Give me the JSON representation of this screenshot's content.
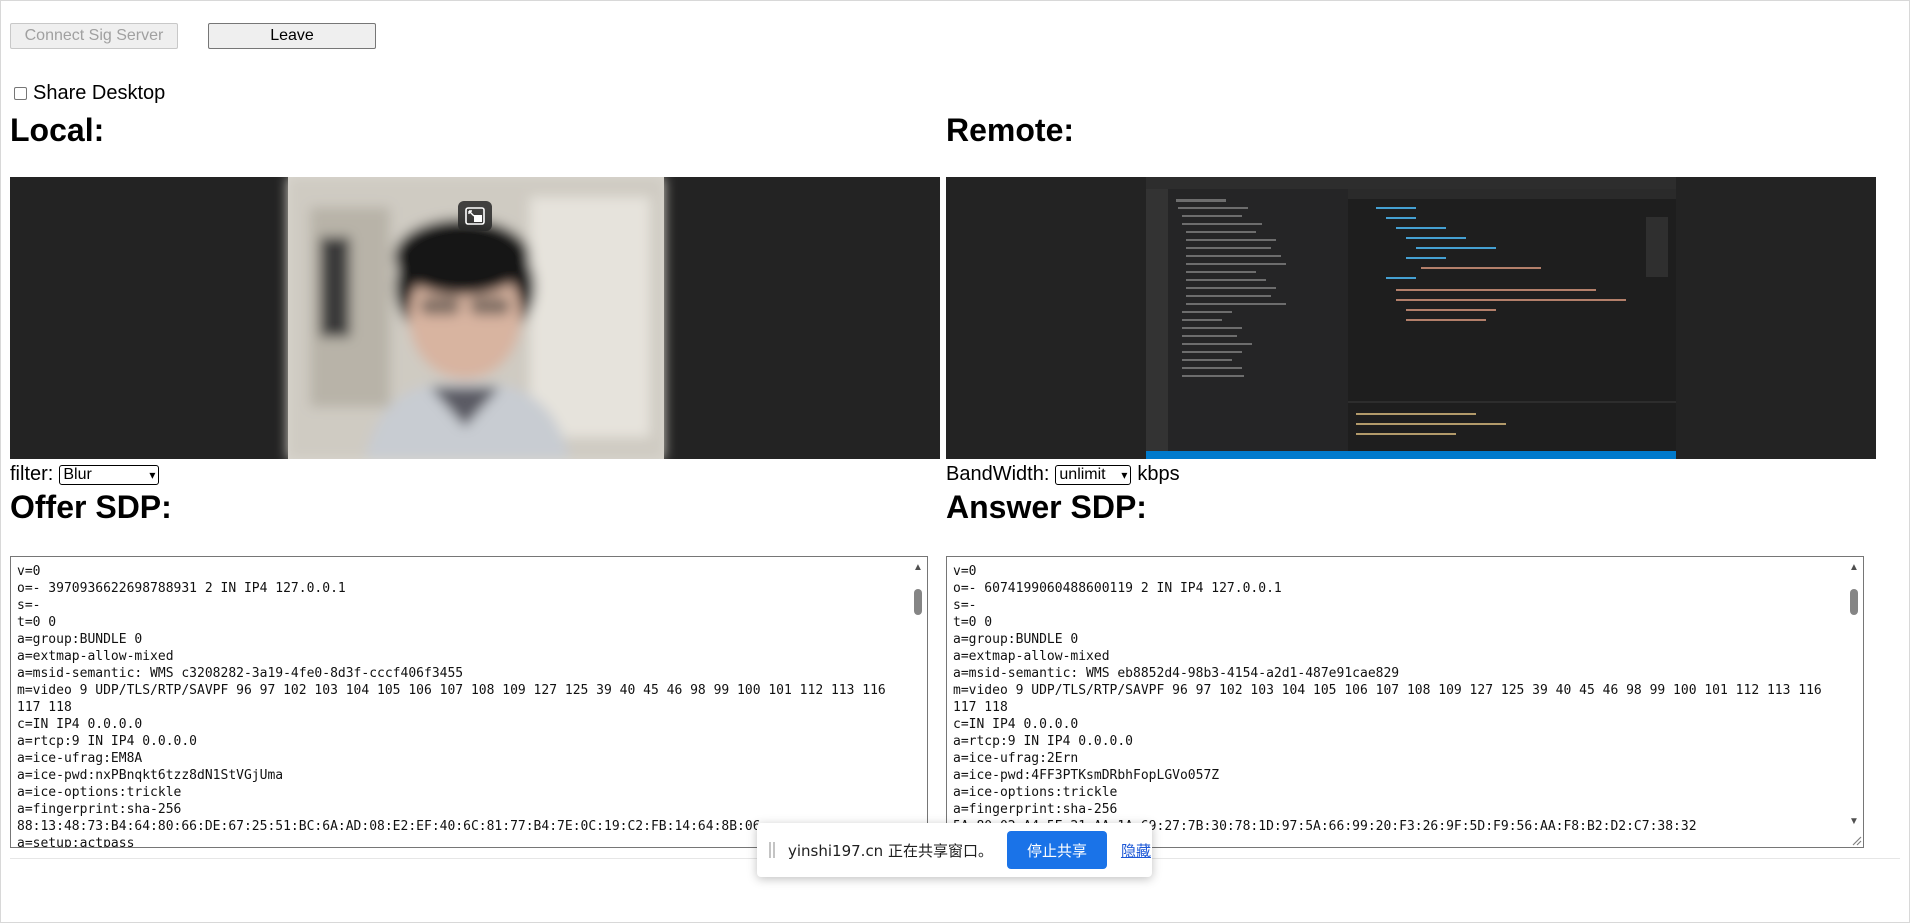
{
  "toolbar": {
    "connect_label": "Connect Sig Server",
    "leave_label": "Leave"
  },
  "share_desktop": {
    "label": "Share Desktop",
    "checked": false
  },
  "local": {
    "heading": "Local:",
    "filter_label": "filter:",
    "filter_value": "Blur"
  },
  "remote": {
    "heading": "Remote:",
    "bandwidth_label": "BandWidth:",
    "bandwidth_value": "unlimit",
    "bandwidth_unit": "kbps"
  },
  "offer": {
    "heading": "Offer SDP:",
    "text": "v=0\no=- 3970936622698788931 2 IN IP4 127.0.0.1\ns=-\nt=0 0\na=group:BUNDLE 0\na=extmap-allow-mixed\na=msid-semantic: WMS c3208282-3a19-4fe0-8d3f-cccf406f3455\nm=video 9 UDP/TLS/RTP/SAVPF 96 97 102 103 104 105 106 107 108 109 127 125 39 40 45 46 98 99 100 101 112 113 116 117 118\nc=IN IP4 0.0.0.0\na=rtcp:9 IN IP4 0.0.0.0\na=ice-ufrag:EM8A\na=ice-pwd:nxPBnqkt6tzz8dN1StVGjUma\na=ice-options:trickle\na=fingerprint:sha-256\n88:13:48:73:B4:64:80:66:DE:67:25:51:BC:6A:AD:08:E2:EF:40:6C:81:77:B4:7E:0C:19:C2:FB:14:64:8B:06\na=setup:actpass"
  },
  "answer": {
    "heading": "Answer SDP:",
    "text": "v=0\no=- 6074199060488600119 2 IN IP4 127.0.0.1\ns=-\nt=0 0\na=group:BUNDLE 0\na=extmap-allow-mixed\na=msid-semantic: WMS eb8852d4-98b3-4154-a2d1-487e91cae829\nm=video 9 UDP/TLS/RTP/SAVPF 96 97 102 103 104 105 106 107 108 109 127 125 39 40 45 46 98 99 100 101 112 113 116 117 118\nc=IN IP4 0.0.0.0\na=rtcp:9 IN IP4 0.0.0.0\na=ice-ufrag:2Ern\na=ice-pwd:4FF3PTKsmDRbhFopLGVo057Z\na=ice-options:trickle\na=fingerprint:sha-256\n5A:80:02:A4:5E:21:AA:1A:69:27:7B:30:78:1D:97:5A:66:99:20:F3:26:9F:5D:F9:56:AA:F8:B2:D2:C7:38:32"
  },
  "share_bar": {
    "text": "yinshi197.cn 正在共享窗口。",
    "stop_label": "停止共享",
    "hide_label": "隐藏"
  },
  "colors": {
    "accent": "#1a73e8",
    "video_bg": "#232323"
  }
}
